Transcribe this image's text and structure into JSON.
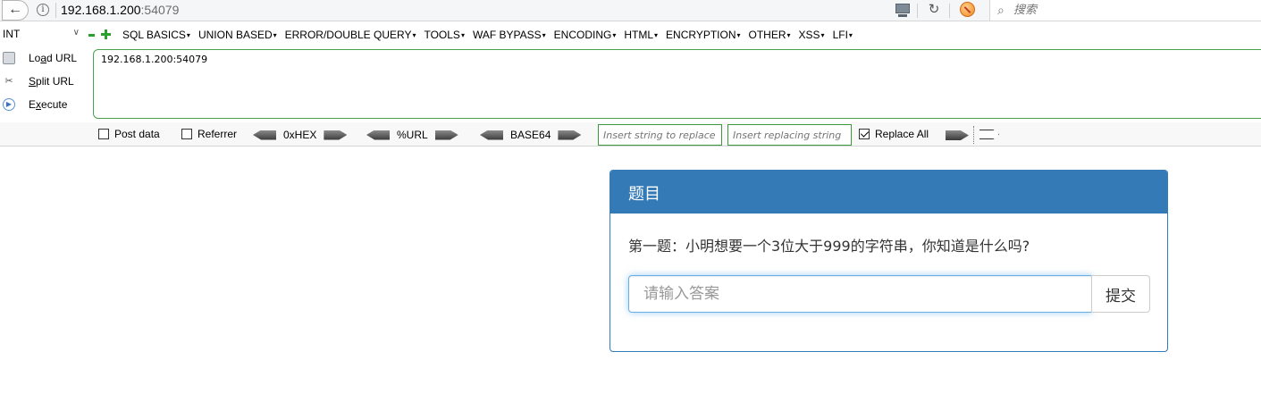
{
  "browser": {
    "url_host": "192.168.1.200",
    "url_port": ":54079",
    "search_placeholder": "搜索"
  },
  "hackbar": {
    "type_select": "INT",
    "menu": [
      "SQL BASICS",
      "UNION BASED",
      "ERROR/DOUBLE QUERY",
      "TOOLS",
      "WAF BYPASS",
      "ENCODING",
      "HTML",
      "ENCRYPTION",
      "OTHER",
      "XSS",
      "LFI"
    ],
    "load_url": "Load URL",
    "split_url": "Split URL",
    "execute": "Execute",
    "url_value": "192.168.1.200:54079",
    "post_data": "Post data",
    "referrer": "Referrer",
    "hex": "0xHEX",
    "url_enc": "%URL",
    "base64": "BASE64",
    "replace_from_placeholder": "Insert string to replace",
    "replace_to_placeholder": "Insert replacing string",
    "replace_all": "Replace All",
    "replace_all_checked": true
  },
  "panel": {
    "title": "题目",
    "question": "第一题：小明想要一个3位大于999的字符串，你知道是什么吗?",
    "answer_placeholder": "请输入答案",
    "submit_label": "提交",
    "accent_color": "#337ab7"
  }
}
